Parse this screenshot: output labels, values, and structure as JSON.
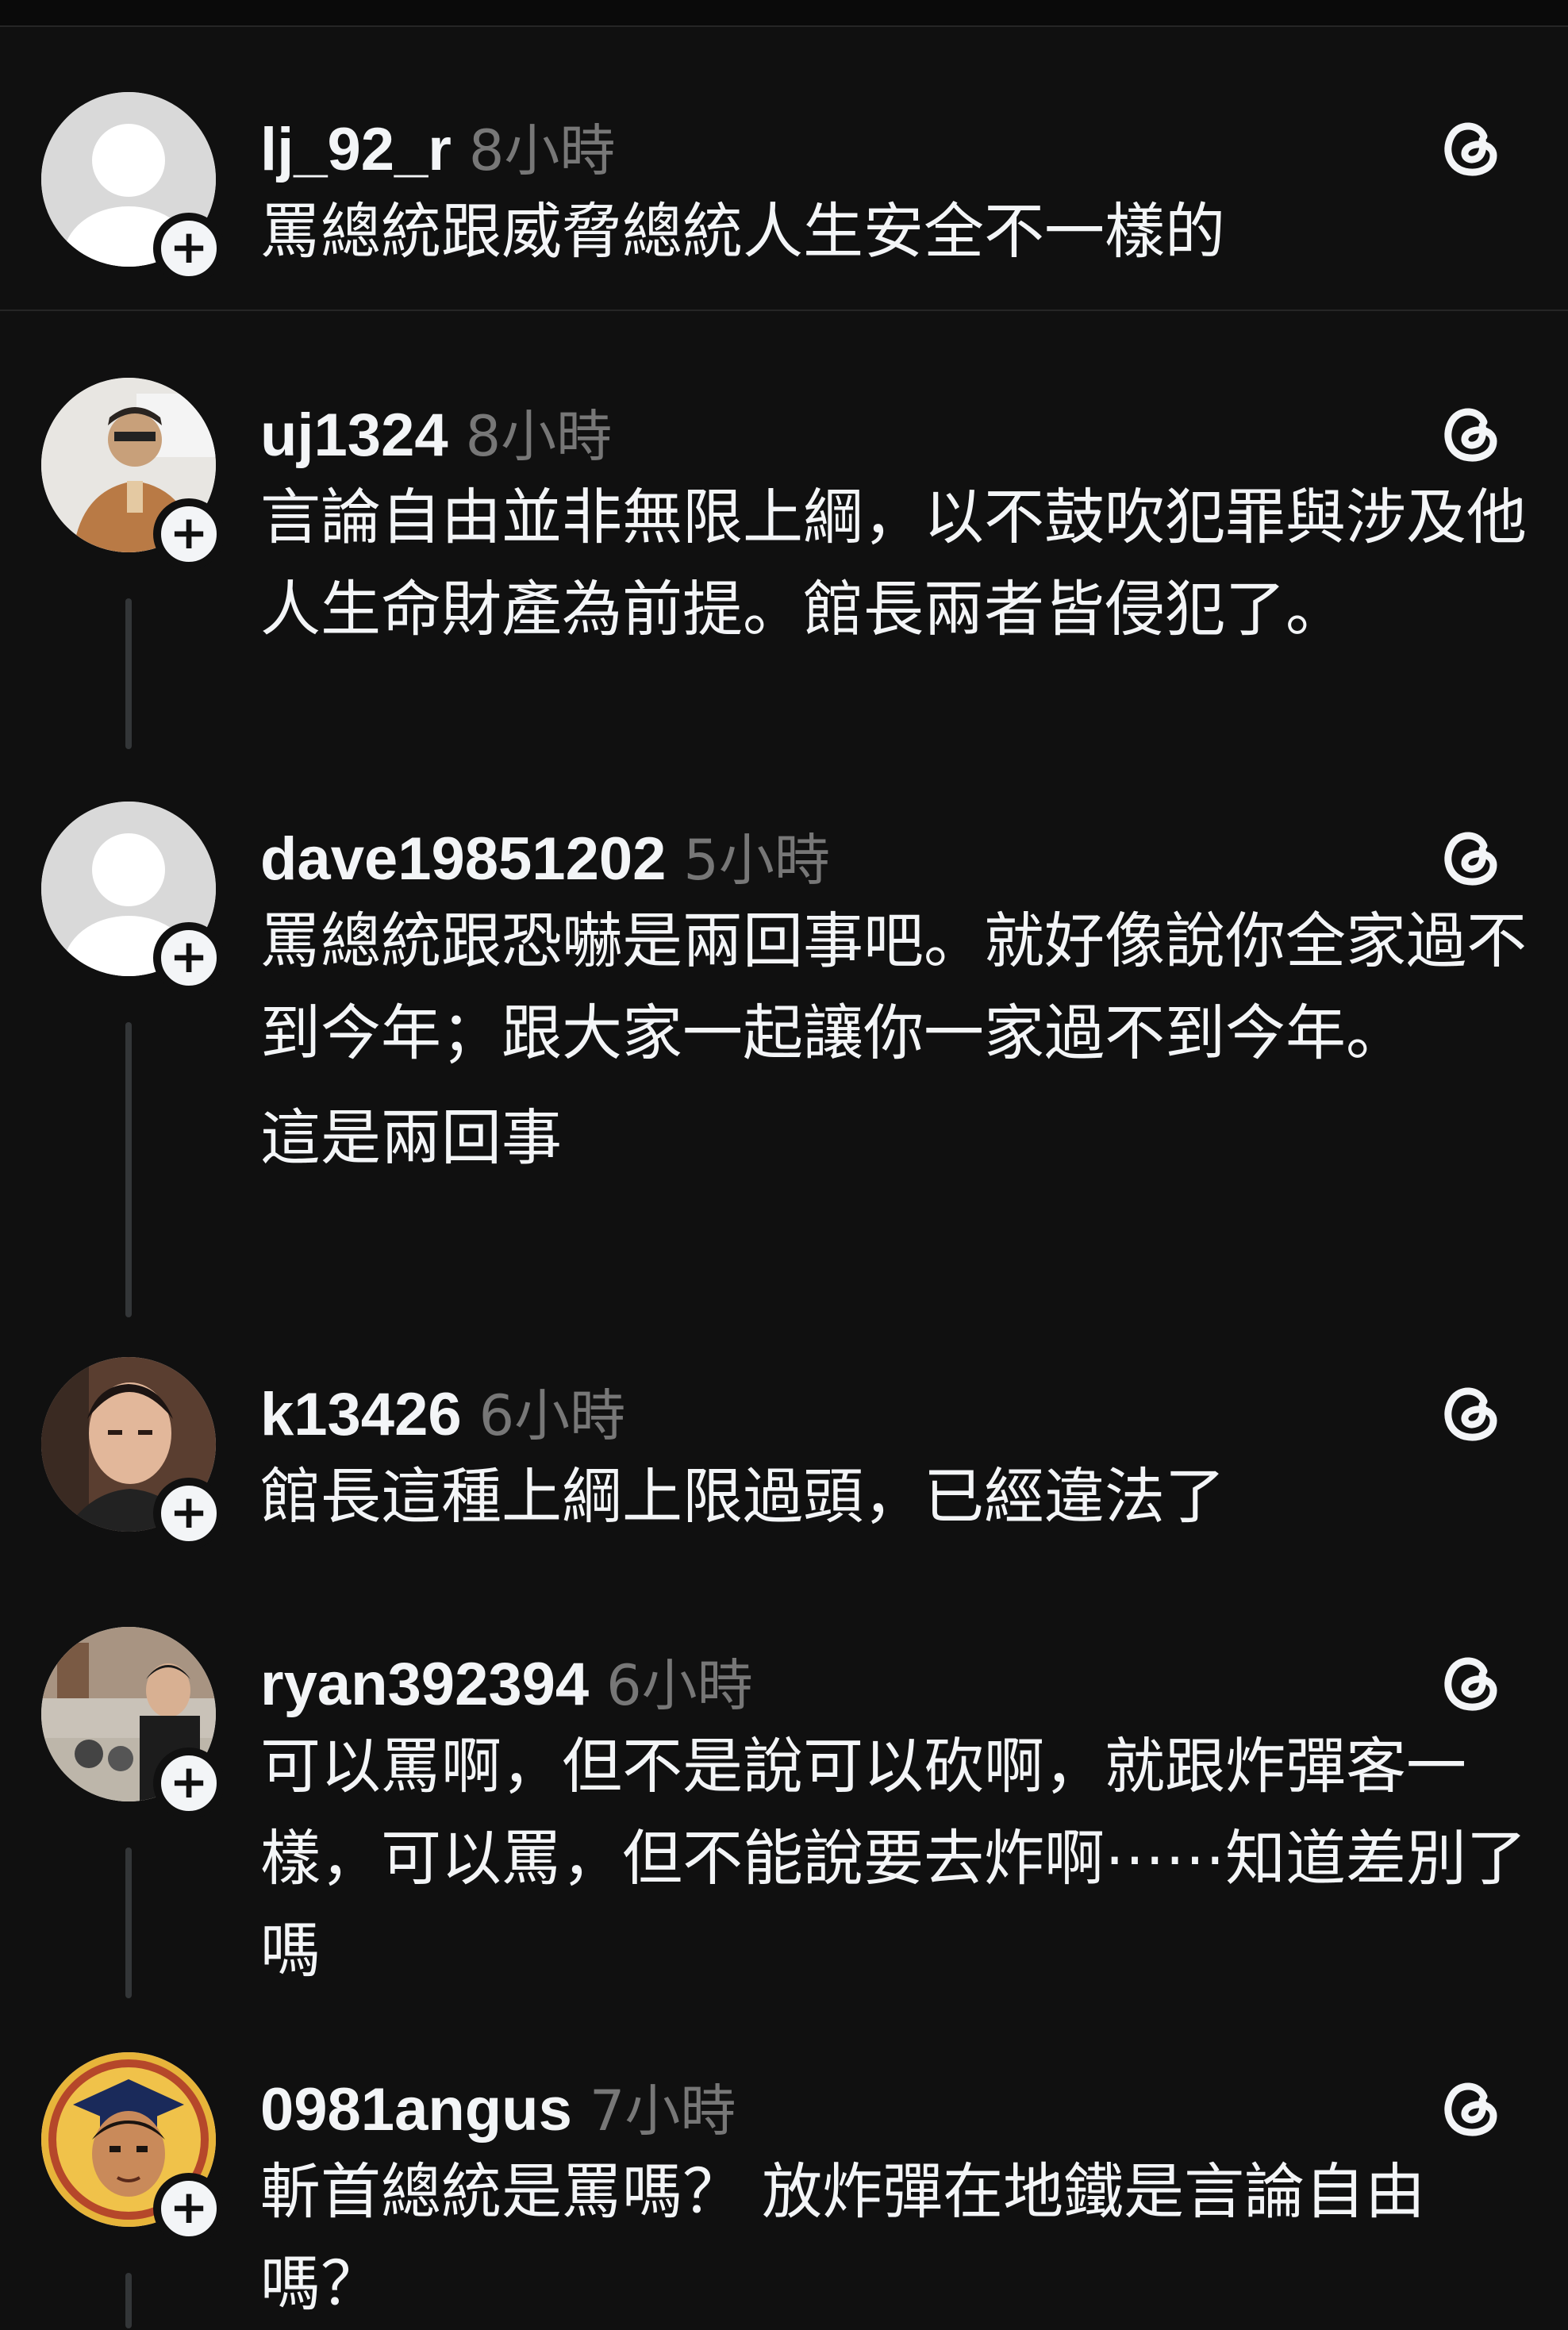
{
  "posts": [
    {
      "username": "lj_92_r",
      "time": "8小時",
      "avatar": "default-avatar",
      "text": [
        "罵總統跟威脅總統人生安全不一樣的"
      ]
    },
    {
      "username": "uj1324",
      "time": "8小時",
      "avatar": "photo-avatar",
      "text": [
        "言論自由並非無限上綱，以不鼓吹犯罪與涉及他人生命財產為前提。館長兩者皆侵犯了。"
      ]
    },
    {
      "username": "dave19851202",
      "time": "5小時",
      "avatar": "default-avatar",
      "text": [
        "罵總統跟恐嚇是兩回事吧。就好像說你全家過不到今年；跟大家一起讓你一家過不到今年。",
        "這是兩回事"
      ]
    },
    {
      "username": "k13426",
      "time": "6小時",
      "avatar": "photo-avatar",
      "text": [
        "館長這種上綱上限過頭，已經違法了"
      ]
    },
    {
      "username": "ryan392394",
      "time": "6小時",
      "avatar": "photo-avatar",
      "text": [
        "可以罵啊，但不是說可以砍啊，就跟炸彈客一樣，可以罵，但不能說要去炸啊⋯⋯知道差別了嗎"
      ]
    },
    {
      "username": "0981angus",
      "time": "7小時",
      "avatar": "illustrated-avatar",
      "text": [
        "斬首總統是罵嗎？ 放炸彈在地鐵是言論自由嗎？"
      ]
    }
  ],
  "icons": {
    "follow": "plus-icon",
    "threads": "threads-icon"
  },
  "colors": {
    "background": "#101010",
    "text": "#f3f5f7",
    "muted": "#777777",
    "divider": "#262626"
  }
}
